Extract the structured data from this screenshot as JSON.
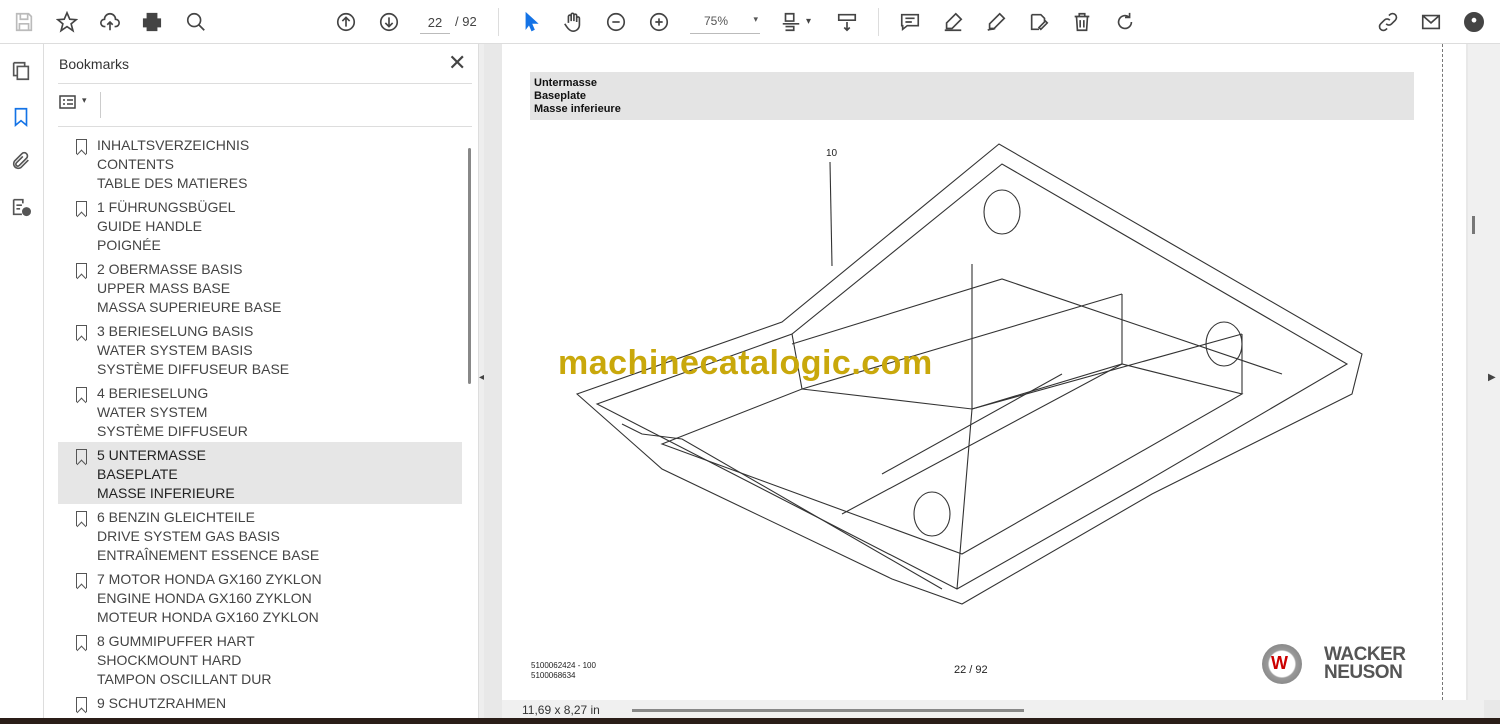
{
  "toolbar": {
    "page_current": "22",
    "page_total": "/ 92",
    "zoom": "75%"
  },
  "panel": {
    "title": "Bookmarks"
  },
  "bookmarks": [
    {
      "lines": [
        "INHALTSVERZEICHNIS",
        "CONTENTS",
        "TABLE DES MATIERES"
      ]
    },
    {
      "lines": [
        "1 FÜHRUNGSBÜGEL",
        "GUIDE HANDLE",
        "POIGNÉE"
      ]
    },
    {
      "lines": [
        "2 OBERMASSE BASIS",
        "UPPER MASS BASE",
        "MASSA SUPERIEURE BASE"
      ]
    },
    {
      "lines": [
        "3 BERIESELUNG BASIS",
        "WATER SYSTEM BASIS",
        "SYSTÈME DIFFUSEUR BASE"
      ]
    },
    {
      "lines": [
        "4 BERIESELUNG",
        "WATER SYSTEM",
        "SYSTÈME DIFFUSEUR"
      ]
    },
    {
      "lines": [
        "5 UNTERMASSE",
        "BASEPLATE",
        "MASSE INFERIEURE"
      ],
      "selected": true
    },
    {
      "lines": [
        "6 BENZIN GLEICHTEILE",
        "DRIVE SYSTEM GAS BASIS",
        "ENTRAÎNEMENT ESSENCE BASE"
      ]
    },
    {
      "lines": [
        "7 MOTOR HONDA GX160 ZYKLON",
        "ENGINE  HONDA GX160 ZYKLON",
        "MOTEUR HONDA GX160 ZYKLON"
      ]
    },
    {
      "lines": [
        "8 GUMMIPUFFER HART",
        "SHOCKMOUNT HARD",
        "TAMPON OSCILLANT DUR"
      ]
    },
    {
      "lines": [
        "9 SCHUTZRAHMEN"
      ]
    }
  ],
  "document": {
    "header": [
      "Untermasse",
      "Baseplate",
      "Masse inferieure"
    ],
    "callout": "10",
    "watermark": "machinecatalogic.com",
    "part_numbers": [
      "5100062424 - 100",
      "5100068634"
    ],
    "page_label": "22 / 92",
    "brand": [
      "WACKER",
      "NEUSON"
    ],
    "logo_letter": "W"
  },
  "status": {
    "dimensions": "11,69 x 8,27 in"
  }
}
